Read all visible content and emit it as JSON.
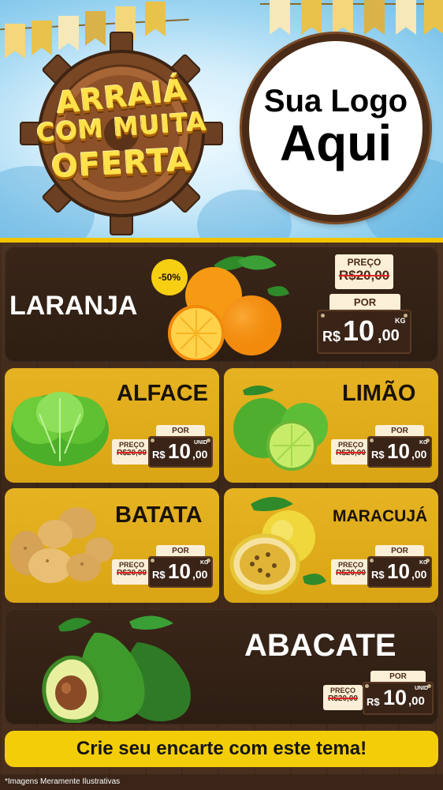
{
  "header": {
    "badge_lines": [
      "ARRAIÁ",
      "COM MUITA",
      "OFERTA"
    ],
    "logo_lines": [
      "Sua Logo",
      "Aqui"
    ],
    "flag_colors": [
      "#f3d77a",
      "#e9c24c",
      "#f6e8b8",
      "#d9b24a"
    ]
  },
  "products": {
    "laranja": {
      "name": "LARANJA",
      "discount": "-50%",
      "de_label": "PREÇO",
      "old_price": "R$20,00",
      "por_label": "POR",
      "currency": "R$",
      "price_int": "10",
      "price_dec": ",00",
      "unit": "KG"
    },
    "alface": {
      "name": "ALFACE",
      "de_label": "PREÇO",
      "old_price": "R$20,00",
      "por_label": "POR",
      "currency": "R$",
      "price_int": "10",
      "price_dec": ",00",
      "unit": "UNID"
    },
    "limao": {
      "name": "LIMÃO",
      "de_label": "PREÇO",
      "old_price": "R$20,00",
      "por_label": "POR",
      "currency": "R$",
      "price_int": "10",
      "price_dec": ",00",
      "unit": "KG"
    },
    "batata": {
      "name": "BATATA",
      "de_label": "PREÇO",
      "old_price": "R$20,00",
      "por_label": "POR",
      "currency": "R$",
      "price_int": "10",
      "price_dec": ",00",
      "unit": "KG"
    },
    "maracuja": {
      "name": "MARACUJÁ",
      "de_label": "PREÇO",
      "old_price": "R$20,00",
      "por_label": "POR",
      "currency": "R$",
      "price_int": "10",
      "price_dec": ",00",
      "unit": "KG"
    },
    "abacate": {
      "name": "ABACATE",
      "de_label": "PREÇO",
      "old_price": "R$20,00",
      "por_label": "POR",
      "currency": "R$",
      "price_int": "10",
      "price_dec": ",00",
      "unit": "UNID"
    }
  },
  "cta": "Crie seu encarte com este tema!",
  "disclaimer": "*Imagens Meramente Ilustrativas",
  "colors": {
    "accent_yellow": "#f3cd08",
    "card_gold": "#e0ad1c",
    "wood_dark": "#3b2618",
    "tag_cream": "#fbefd8",
    "strike_red": "#e02020"
  }
}
